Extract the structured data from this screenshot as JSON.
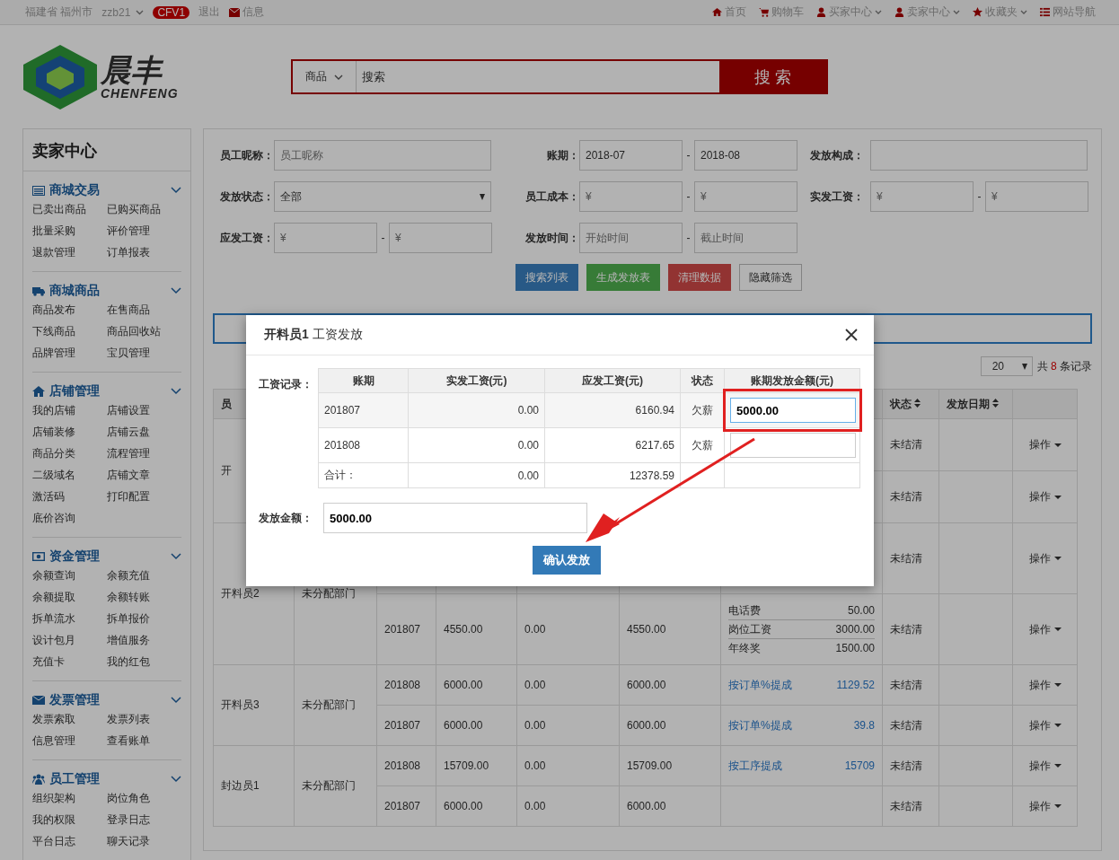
{
  "top_bar": {
    "region": "福建省 福州市",
    "user": "zzb21",
    "level_badge": "CFV1",
    "logout": "退出",
    "messages": "信息",
    "nav": [
      {
        "label": "首页",
        "dropdown": false
      },
      {
        "label": "购物车",
        "dropdown": false
      },
      {
        "label": "买家中心",
        "dropdown": true
      },
      {
        "label": "卖家中心",
        "dropdown": true
      },
      {
        "label": "收藏夹",
        "dropdown": true
      },
      {
        "label": "网站导航",
        "dropdown": false
      }
    ]
  },
  "logo": {
    "name": "晨丰",
    "latin": "CHENFENG"
  },
  "search": {
    "category": "商品",
    "value": "搜索",
    "button": "搜 索"
  },
  "sidebar": {
    "title": "卖家中心",
    "sections": [
      {
        "title": "商城交易",
        "expanded": true,
        "items": [
          "已卖出商品",
          "已购买商品",
          "批量采购",
          "评价管理",
          "退款管理",
          "订单报表"
        ]
      },
      {
        "title": "商城商品",
        "expanded": true,
        "items": [
          "商品发布",
          "在售商品",
          "下线商品",
          "商品回收站",
          "品牌管理",
          "宝贝管理"
        ]
      },
      {
        "title": "店铺管理",
        "expanded": true,
        "items": [
          "我的店铺",
          "店铺设置",
          "店铺装修",
          "店铺云盘",
          "商品分类",
          "流程管理",
          "二级域名",
          "店铺文章",
          "激活码",
          "打印配置",
          "底价咨询"
        ]
      },
      {
        "title": "资金管理",
        "expanded": true,
        "items": [
          "余额查询",
          "余额充值",
          "余额提取",
          "余额转账",
          "拆单流水",
          "拆单报价",
          "设计包月",
          "增值服务",
          "充值卡",
          "我的红包"
        ]
      },
      {
        "title": "发票管理",
        "expanded": true,
        "items": [
          "发票索取",
          "发票列表",
          "信息管理",
          "查看账单"
        ]
      },
      {
        "title": "员工管理",
        "expanded": true,
        "items": [
          "组织架构",
          "岗位角色",
          "我的权限",
          "登录日志",
          "平台日志",
          "聊天记录"
        ]
      }
    ]
  },
  "filters": [
    [
      {
        "label": "员工昵称：",
        "inputs": [
          {
            "kind": "text",
            "placeholder": "员工昵称"
          }
        ]
      },
      {
        "label": "账期：",
        "separator": "-",
        "inputs": [
          {
            "kind": "text",
            "value": "2018-07"
          },
          {
            "kind": "text",
            "value": "2018-08"
          }
        ]
      },
      {
        "label": "发放构成：",
        "inputs": [
          {
            "kind": "text"
          }
        ]
      }
    ],
    [
      {
        "label": "发放状态：",
        "inputs": [
          {
            "kind": "select",
            "value": "全部"
          }
        ]
      },
      {
        "label": "员工成本：",
        "separator": "-",
        "inputs": [
          {
            "kind": "text",
            "placeholder": "¥"
          },
          {
            "kind": "text",
            "placeholder": "¥"
          }
        ]
      },
      {
        "label": "实发工资：",
        "separator": "-",
        "inputs": [
          {
            "kind": "text",
            "placeholder": "¥"
          },
          {
            "kind": "text",
            "placeholder": "¥"
          }
        ]
      }
    ],
    [
      {
        "label": "应发工资：",
        "separator": "-",
        "inputs": [
          {
            "kind": "text",
            "placeholder": "¥"
          },
          {
            "kind": "text",
            "placeholder": "¥"
          }
        ]
      },
      {
        "label": "发放时间：",
        "separator": "-",
        "inputs": [
          {
            "kind": "text",
            "placeholder": "开始时间"
          },
          {
            "kind": "text",
            "placeholder": "截止时间"
          }
        ]
      }
    ]
  ],
  "filter_buttons": [
    {
      "label": "搜索列表",
      "kind": "primary"
    },
    {
      "label": "生成发放表",
      "kind": "success"
    },
    {
      "label": "清理数据",
      "kind": "danger"
    },
    {
      "label": "隐藏筛选",
      "kind": "default"
    }
  ],
  "pager": {
    "page_size": "20",
    "total_prefix": "共",
    "total_count": "8",
    "total_suffix": "条记录"
  },
  "table": {
    "header_cells": [
      {
        "label": "员",
        "sortable": false
      },
      {
        "label": "状态",
        "sortable": true
      },
      {
        "label": "发放日期",
        "sortable": true
      }
    ],
    "groups": [
      {
        "name": "开",
        "rows": [
          {
            "status": "未结清",
            "action": "操作"
          },
          {
            "status": "未结清",
            "action": "操作"
          }
        ]
      },
      {
        "name": "开料员2",
        "department": "未分配部门",
        "rows": [
          {
            "status": "未结清",
            "action": "操作"
          },
          {
            "period": "201807",
            "amount_1": "4550.00",
            "amount_2": "0.00",
            "amount_3": "4550.00",
            "composition": [
              {
                "kind": "plain",
                "label": "电话费",
                "amount": "50.00"
              },
              {
                "kind": "plain",
                "label": "岗位工资",
                "amount": "3000.00"
              },
              {
                "kind": "plain",
                "label": "年终奖",
                "amount": "1500.00"
              }
            ],
            "status": "未结清",
            "action": "操作"
          }
        ]
      },
      {
        "name": "开料员3",
        "department": "未分配部门",
        "rows": [
          {
            "period": "201808",
            "amount_1": "6000.00",
            "amount_2": "0.00",
            "amount_3": "6000.00",
            "composition": [
              {
                "kind": "link",
                "label": "按订单%提成",
                "amount": "1129.52"
              }
            ],
            "status": "未结清",
            "action": "操作"
          },
          {
            "period": "201807",
            "amount_1": "6000.00",
            "amount_2": "0.00",
            "amount_3": "6000.00",
            "composition": [
              {
                "kind": "link",
                "label": "按订单%提成",
                "amount": "39.8"
              }
            ],
            "status": "未结清",
            "action": "操作"
          }
        ]
      },
      {
        "name": "封边员1",
        "department": "未分配部门",
        "rows": [
          {
            "period": "201808",
            "amount_1": "15709.00",
            "amount_2": "0.00",
            "amount_3": "15709.00",
            "composition": [
              {
                "kind": "link",
                "label": "按工序提成",
                "amount": "15709"
              }
            ],
            "status": "未结清",
            "action": "操作"
          },
          {
            "period": "201807",
            "amount_1": "6000.00",
            "amount_2": "0.00",
            "amount_3": "6000.00",
            "status": "未结清",
            "action": "操作"
          }
        ]
      }
    ]
  },
  "modal": {
    "title": "**开料员1** 工资发放",
    "records_label": "工资记录：",
    "columns": [
      "账期",
      "实发工资(元)",
      "应发工资(元)",
      "状态",
      "账期发放金额(元)"
    ],
    "records": [
      {
        "period": "201807",
        "actual": "0.00",
        "due": "6160.94",
        "status": "欠薪",
        "amount": "5000.00",
        "highlighted": true
      },
      {
        "period": "201808",
        "actual": "0.00",
        "due": "6217.65",
        "status": "欠薪",
        "highlighted": false
      }
    ],
    "total": {
      "label": "合计：",
      "actual": "0.00",
      "due": "12378.59"
    },
    "amount_label": "发放金额：",
    "amount": "5000.00",
    "confirm": "确认发放"
  }
}
